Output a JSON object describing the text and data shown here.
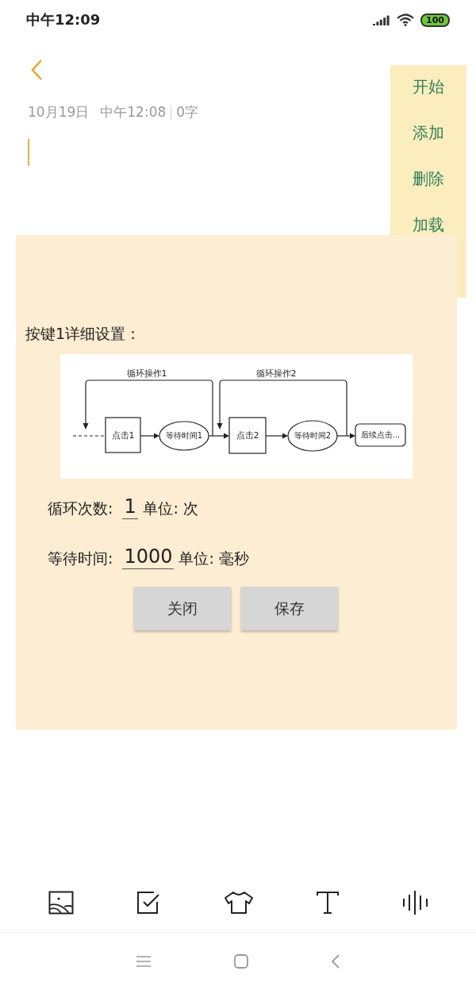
{
  "status_bar": {
    "time": "中午12:09",
    "battery": "100"
  },
  "note": {
    "date": "10月19日",
    "time": "中午12:08",
    "word_count": "0字"
  },
  "side_menu": {
    "items": [
      "开始",
      "添加",
      "删除",
      "加载"
    ]
  },
  "dialog": {
    "title": "按键1详细设置：",
    "diagram": {
      "loops": [
        {
          "label": "循环操作1"
        },
        {
          "label": "循环操作2"
        }
      ],
      "nodes": [
        {
          "kind": "rect",
          "label": "点击1"
        },
        {
          "kind": "ellipse",
          "label": "等待时间1"
        },
        {
          "kind": "rect",
          "label": "点击2"
        },
        {
          "kind": "ellipse",
          "label": "等待时间2"
        },
        {
          "kind": "rounded",
          "label": "后续点击..."
        }
      ]
    },
    "fields": [
      {
        "label": "循环次数:",
        "value": "1",
        "unit": "单位: 次"
      },
      {
        "label": "等待时间:",
        "value": "1000",
        "unit": "单位: 毫秒"
      }
    ],
    "buttons": [
      "关闭",
      "保存"
    ]
  }
}
